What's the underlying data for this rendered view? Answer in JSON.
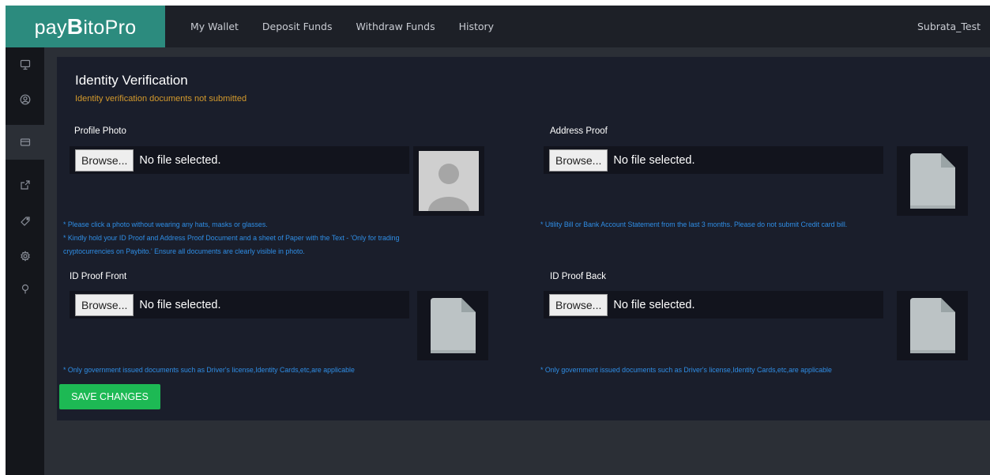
{
  "brand": {
    "prefix": "pay",
    "b": "B",
    "suffix": "itoPro"
  },
  "nav": {
    "items": [
      "My Wallet",
      "Deposit Funds",
      "Withdraw Funds",
      "History"
    ],
    "user": "Subrata_Test"
  },
  "sidebar": {
    "icons": [
      "monitor-icon",
      "user-circle-icon",
      "card-icon",
      "share-icon",
      "tag-icon",
      "gear-icon",
      "location-pin-icon"
    ],
    "active_index": 2
  },
  "page": {
    "title": "Identity Verification",
    "status": "Identity verification documents not submitted"
  },
  "fields": {
    "profile_photo": {
      "label": "Profile Photo",
      "button": "Browse...",
      "value": "No file selected.",
      "hints": [
        "* Please click a photo without wearing any hats, masks or glasses.",
        "* Kindly hold your ID Proof and Address Proof Document and a sheet of Paper with the Text - 'Only for trading",
        "cryptocurrencies on Paybito.' Ensure all documents are clearly visible in photo."
      ]
    },
    "address_proof": {
      "label": "Address Proof",
      "button": "Browse...",
      "value": "No file selected.",
      "hint": "* Utility Bill or Bank Account Statement from the last 3 months. Please do not submit Credit card bill."
    },
    "id_front": {
      "label": "ID Proof Front",
      "button": "Browse...",
      "value": "No file selected.",
      "hint": "* Only government issued documents such as Driver's license,Identity Cards,etc,are applicable"
    },
    "id_back": {
      "label": "ID Proof Back",
      "button": "Browse...",
      "value": "No file selected.",
      "hint": "* Only government issued documents such as Driver's license,Identity Cards,etc,are applicable"
    }
  },
  "save_button": "SAVE CHANGES",
  "colors": {
    "brand": "#2c8b7e",
    "status": "#d49a2c",
    "hint": "#2f8ee6",
    "save": "#1db954"
  }
}
